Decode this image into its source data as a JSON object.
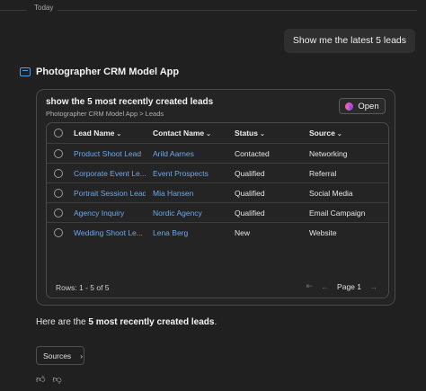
{
  "divider": {
    "label": "Today"
  },
  "user_message": "Show me the latest 5 leads",
  "app": {
    "name": "Photographer CRM Model App"
  },
  "card": {
    "title": "show the 5 most recently created leads",
    "breadcrumb": "Photographer CRM Model App > Leads",
    "open_label": "Open"
  },
  "table": {
    "columns": [
      "Lead Name",
      "Contact Name",
      "Status",
      "Source"
    ],
    "rows": [
      [
        "Product Shoot Lead",
        "Arild Aarnes",
        "Contacted",
        "Networking"
      ],
      [
        "Corporate Event Le...",
        "Event Prospects",
        "Qualified",
        "Referral"
      ],
      [
        "Portrait Session Lead",
        "Mia Hansen",
        "Qualified",
        "Social Media"
      ],
      [
        "Agency Inquiry",
        "Nordic Agency",
        "Qualified",
        "Email Campaign"
      ],
      [
        "Wedding Shoot Le...",
        "Lena Berg",
        "New",
        "Website"
      ]
    ],
    "rows_count": "Rows: 1 - 5 of 5",
    "page_label": "Page 1"
  },
  "response": {
    "prefix": "Here are the ",
    "bold": "5 most recently created leads",
    "suffix": "."
  },
  "sources_label": "Sources",
  "icons": {
    "app": "app-window-icon",
    "chevron": "chevron-down-icon",
    "first": "first-page-icon",
    "prev": "prev-page-icon",
    "next": "next-page-icon",
    "sources": "chevron-right-icon",
    "like": "thumbs-up-icon",
    "dislike": "thumbs-down-icon"
  },
  "colors": {
    "accent_link": "#6aa8ee",
    "background": "#202020",
    "app_icon": "#4aa0e6"
  }
}
